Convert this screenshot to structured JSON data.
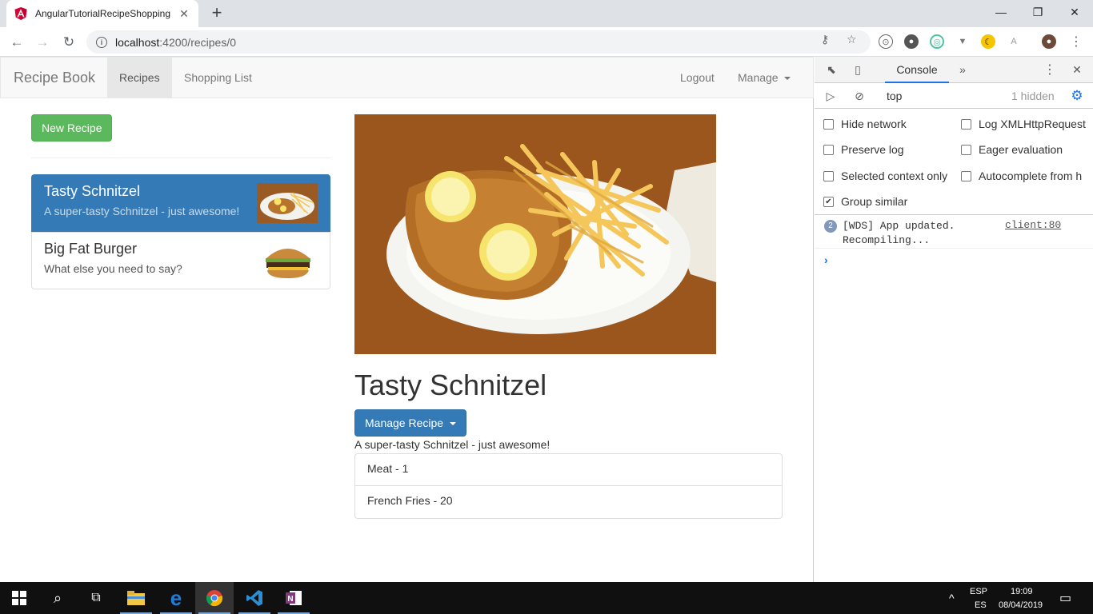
{
  "browser": {
    "tab_title": "AngularTutorialRecipeShopping",
    "url_host": "localhost",
    "url_path": ":4200/recipes/0"
  },
  "app": {
    "brand": "Recipe Book",
    "nav": {
      "recipes": "Recipes",
      "shopping_list": "Shopping List",
      "logout": "Logout",
      "manage": "Manage"
    },
    "new_recipe_label": "New Recipe",
    "recipes": [
      {
        "name": "Tasty Schnitzel",
        "description": "A super-tasty Schnitzel - just awesome!",
        "active": true
      },
      {
        "name": "Big Fat Burger",
        "description": "What else you need to say?",
        "active": false
      }
    ],
    "detail": {
      "title": "Tasty Schnitzel",
      "manage_label": "Manage Recipe",
      "description": "A super-tasty Schnitzel - just awesome!",
      "ingredients": [
        "Meat - 1",
        "French Fries - 20"
      ]
    }
  },
  "devtools": {
    "tab_console": "Console",
    "context": "top",
    "hidden": "1 hidden",
    "settings": {
      "hide_network": "Hide network",
      "log_xhr": "Log XMLHttpRequest",
      "preserve_log": "Preserve log",
      "eager_eval": "Eager evaluation",
      "selected_context": "Selected context only",
      "autocomplete": "Autocomplete from h",
      "group_similar": "Group similar"
    },
    "message": {
      "count": "2",
      "text": "[WDS] App updated.\nRecompiling...",
      "source": "client:80"
    }
  },
  "taskbar": {
    "lang1": "ESP",
    "lang2": "ES",
    "time": "19:09",
    "date": "08/04/2019"
  },
  "colors": {
    "primary": "#337ab7",
    "success": "#5cb85c",
    "devtools_accent": "#1a73e8"
  }
}
